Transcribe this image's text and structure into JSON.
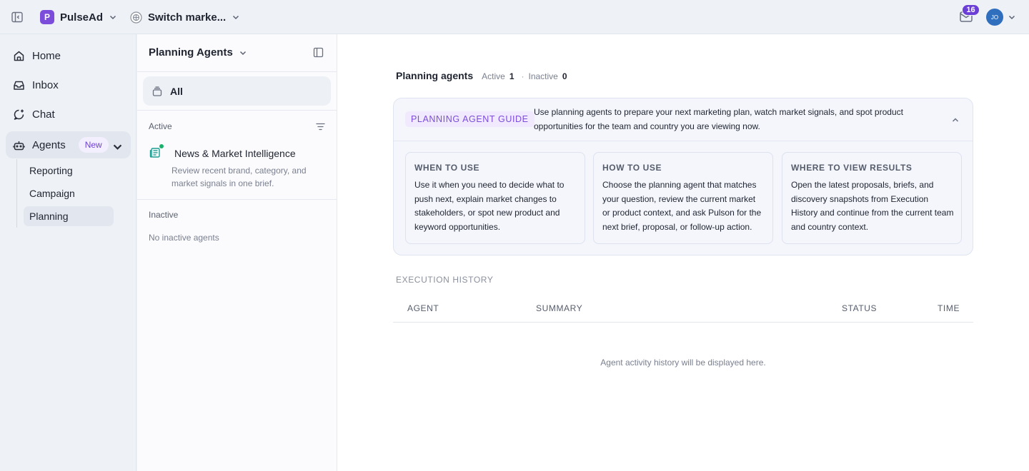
{
  "topbar": {
    "brand_logo_letter": "P",
    "brand_name": "PulseAd",
    "market_name": "Switch marke...",
    "inbox_count": "16",
    "avatar_initials": "JO"
  },
  "leftnav": {
    "items": [
      {
        "label": "Home",
        "icon": "home-icon"
      },
      {
        "label": "Inbox",
        "icon": "inbox-icon"
      },
      {
        "label": "Chat",
        "icon": "chat-icon"
      },
      {
        "label": "Agents",
        "icon": "robot-icon",
        "badge": "New"
      }
    ],
    "sub_items": [
      {
        "label": "Reporting"
      },
      {
        "label": "Campaign"
      },
      {
        "label": "Planning",
        "active": true
      }
    ]
  },
  "panel": {
    "title": "Planning Agents",
    "all_label": "All",
    "active_label": "Active",
    "inactive_label": "Inactive",
    "agent": {
      "name": "News & Market Intelligence",
      "description": "Review recent brand, category, and market signals in one brief.",
      "status_color": "#18b26b"
    },
    "empty_inactive": "No inactive agents"
  },
  "main": {
    "stats_title": "Planning agents",
    "active_label": "Active",
    "active_count": "1",
    "inactive_label": "Inactive",
    "inactive_count": "0",
    "guide": {
      "tag": "PLANNING AGENT GUIDE",
      "text": "Use planning agents to prepare your next marketing plan, watch market signals, and spot product opportunities for the team and country you are viewing now.",
      "cards": [
        {
          "title": "WHEN TO USE",
          "text": "Use it when you need to decide what to push next, explain market changes to stakeholders, or spot new product and keyword opportunities."
        },
        {
          "title": "HOW TO USE",
          "text": "Choose the planning agent that matches your question, review the current market or product context, and ask Pulson for the next brief, proposal, or follow-up action."
        },
        {
          "title": "WHERE TO VIEW RESULTS",
          "text": "Open the latest proposals, briefs, and discovery snapshots from Execution History and continue from the current team and country context."
        }
      ]
    },
    "execution_history_label": "EXECUTION HISTORY",
    "columns": [
      "AGENT",
      "SUMMARY",
      "STATUS",
      "TIME"
    ],
    "empty_history": "Agent activity history will be displayed here."
  },
  "colors": {
    "accent": "#6b3fd6",
    "brand_logo": "#7c4ddb",
    "avatar": "#2f6fbd",
    "active_status": "#18b26b"
  }
}
